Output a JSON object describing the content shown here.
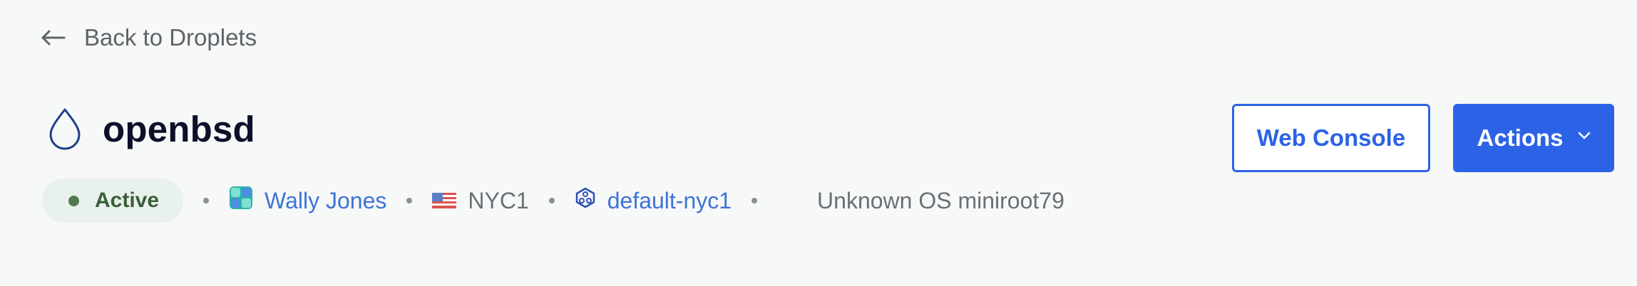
{
  "nav": {
    "back_label": "Back to Droplets",
    "back_icon": "arrow-left-icon"
  },
  "droplet": {
    "name": "openbsd",
    "icon": "droplet-icon",
    "status": "Active",
    "status_color": "#4f7a4d",
    "owner": "Wally Jones",
    "owner_icon": "team-avatar-icon",
    "region": "NYC1",
    "region_icon": "us-flag-icon",
    "vpc": "default-nyc1",
    "vpc_icon": "vpc-network-icon",
    "os": "Unknown OS miniroot79"
  },
  "actions": {
    "console_label": "Web Console",
    "actions_label": "Actions",
    "actions_icon": "chevron-down-icon"
  },
  "colors": {
    "accent": "#2c63e6",
    "link": "#3d74d6",
    "background": "#f7f8f8",
    "status_badge_bg": "#e9f1ec"
  }
}
